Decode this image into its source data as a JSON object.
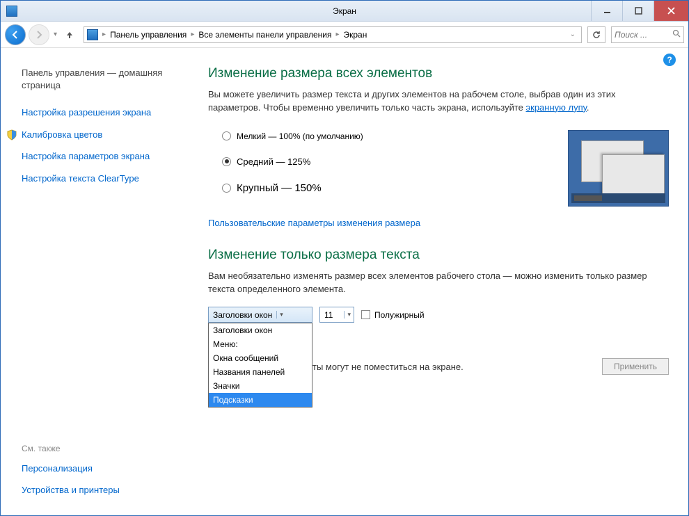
{
  "window": {
    "title": "Экран"
  },
  "nav": {
    "breadcrumb": [
      "Панель управления",
      "Все элементы панели управления",
      "Экран"
    ],
    "search_placeholder": "Поиск ..."
  },
  "sidebar": {
    "home": "Панель управления — домашняя страница",
    "links": [
      "Настройка разрешения экрана",
      "Калибровка цветов",
      "Настройка параметров экрана",
      "Настройка текста ClearType"
    ],
    "footer_title": "См. также",
    "footer_links": [
      "Персонализация",
      "Устройства и принтеры"
    ]
  },
  "main": {
    "heading1": "Изменение размера всех элементов",
    "desc1_a": "Вы можете увеличить размер текста и других элементов на рабочем столе, выбрав один из этих параметров. Чтобы временно увеличить только часть экрана, используйте ",
    "desc1_link": "экранную лупу",
    "desc1_b": ".",
    "radios": [
      "Мелкий — 100% (по умолчанию)",
      "Средний — 125%",
      "Крупный — 150%"
    ],
    "custom_link": "Пользовательские параметры изменения размера",
    "heading2": "Изменение только размера текста",
    "desc2": "Вам необязательно изменять размер всех элементов рабочего стола — можно изменить только размер текста определенного элемента.",
    "element_combo": "Заголовки окон",
    "fontsize_combo": "11",
    "bold_label": "Полужирный",
    "dropdown_options": [
      "Заголовки окон",
      "Меню:",
      "Окна сообщений",
      "Названия панелей",
      "Значки",
      "Подсказки"
    ],
    "dropdown_highlighted": 5,
    "apply_hint": "ты могут не поместиться на экране.",
    "apply_button": "Применить"
  }
}
